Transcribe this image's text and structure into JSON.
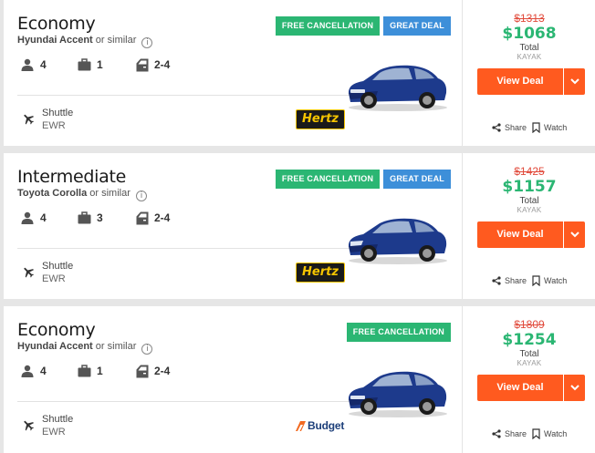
{
  "listings": [
    {
      "category": "Economy",
      "model": "Hyundai Accent",
      "similar": "or similar",
      "passengers": "4",
      "bags": "1",
      "doors": "2-4",
      "pickup_type": "Shuttle",
      "pickup_location": "EWR",
      "badges": [
        "FREE CANCELLATION",
        "GREAT DEAL"
      ],
      "agency": "Hertz",
      "old_price": "$1313",
      "price": "$1068",
      "total_label": "Total",
      "source": "KAYAK",
      "deal_label": "View Deal",
      "share_label": "Share",
      "watch_label": "Watch",
      "car_color": "#1d3a8c"
    },
    {
      "category": "Intermediate",
      "model": "Toyota Corolla",
      "similar": "or similar",
      "passengers": "4",
      "bags": "3",
      "doors": "2-4",
      "pickup_type": "Shuttle",
      "pickup_location": "EWR",
      "badges": [
        "FREE CANCELLATION",
        "GREAT DEAL"
      ],
      "agency": "Hertz",
      "old_price": "$1425",
      "price": "$1157",
      "total_label": "Total",
      "source": "KAYAK",
      "deal_label": "View Deal",
      "share_label": "Share",
      "watch_label": "Watch",
      "car_color": "#1d3a8c"
    },
    {
      "category": "Economy",
      "model": "Hyundai Accent",
      "similar": "or similar",
      "passengers": "4",
      "bags": "1",
      "doors": "2-4",
      "pickup_type": "Shuttle",
      "pickup_location": "EWR",
      "badges": [
        "FREE CANCELLATION"
      ],
      "agency": "Budget",
      "old_price": "$1809",
      "price": "$1254",
      "total_label": "Total",
      "source": "KAYAK",
      "deal_label": "View Deal",
      "share_label": "Share",
      "watch_label": "Watch",
      "car_color": "#1d3a8c"
    }
  ],
  "colors": {
    "accent_orange": "#ff5a1f",
    "price_green": "#2bb673",
    "old_price_red": "#e14b3c",
    "badge_free": "#2bb673",
    "badge_great": "#3d8fd9"
  },
  "icons": {
    "passengers": "person-icon",
    "bags": "briefcase-icon",
    "doors": "car-door-icon",
    "pickup": "airplane-icon",
    "info": "info-icon",
    "dropdown": "chevron-down-icon",
    "share": "share-icon",
    "watch": "bookmark-icon"
  }
}
